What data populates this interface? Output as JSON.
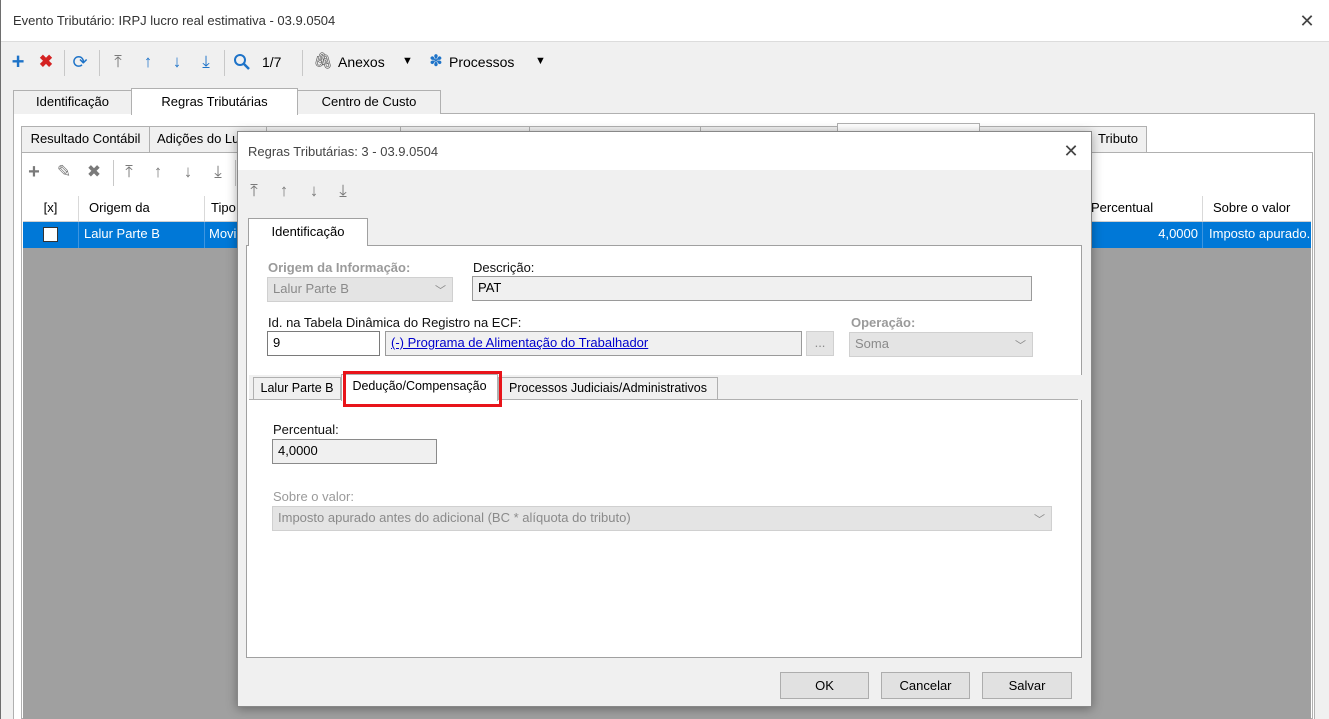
{
  "outer_window": {
    "title": "Evento Tributário: IRPJ lucro real estimativa - 03.9.0504",
    "close_glyph": "✕"
  },
  "toolbar": {
    "record_position": "1/7",
    "anexos_label": "Anexos",
    "processos_label": "Processos",
    "icons": [
      "plus-icon",
      "delete-icon",
      "refresh-icon",
      "first-icon",
      "up-icon",
      "down-icon",
      "last-icon",
      "search-icon",
      "paperclip-icon",
      "gear-icon"
    ]
  },
  "main_tabs": [
    "Identificação",
    "Regras Tributárias",
    "Centro de Custo"
  ],
  "sub_tabs": {
    "first": "Resultado Contábil",
    "second": "Adições do Lu",
    "last": "Tributo"
  },
  "grid": {
    "headers": {
      "check": "[x]",
      "origem": "Origem da",
      "tipo": "Tipo",
      "percentual": "Percentual",
      "sobre": "Sobre o valor"
    },
    "row": {
      "origem": "Lalur Parte B",
      "tipo": "Movi",
      "percentual": "4,0000",
      "sobre": "Imposto apurado."
    }
  },
  "dialog": {
    "title": "Regras Tributárias: 3 - 03.9.0504",
    "close_glyph": "✕",
    "tab": "Identificação",
    "origem_label": "Origem da Informação:",
    "origem_value": "Lalur Parte B",
    "descricao_label": "Descrição:",
    "descricao_value": "PAT",
    "idtab_label": "Id. na Tabela Dinâmica do Registro na ECF:",
    "idtab_value": "9",
    "idtab_link": "(-) Programa de Alimentação do Trabalhador",
    "ellipsis": "...",
    "operacao_label": "Operação:",
    "operacao_value": "Soma",
    "inner_tabs": [
      "Lalur Parte B",
      "Dedução/Compensação",
      "Processos Judiciais/Administrativos"
    ],
    "percentual_label": "Percentual:",
    "percentual_value": "4,0000",
    "sobre_label": "Sobre o valor:",
    "sobre_value": "Imposto apurado antes do adicional (BC * alíquota do tributo)",
    "ok_label": "OK",
    "cancelar_label": "Cancelar",
    "salvar_label": "Salvar",
    "highlight_color": "#e8141a"
  },
  "colors": {
    "selection_blue": "#0078d7",
    "toolbar_blue": "#1e73c8",
    "delete_red": "#d42222",
    "grid_bg": "#a0a0a0",
    "link_blue": "#0000cc"
  }
}
